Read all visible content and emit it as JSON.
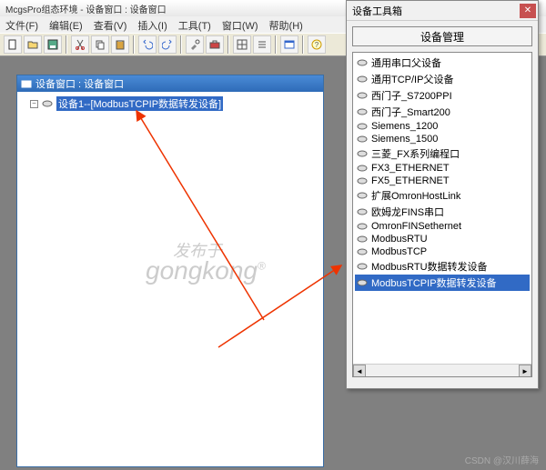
{
  "titlebar": "McgsPro组态环境 - 设备窗口 : 设备窗口",
  "menu": [
    "文件(F)",
    "编辑(E)",
    "查看(V)",
    "插入(I)",
    "工具(T)",
    "窗口(W)",
    "帮助(H)"
  ],
  "devwin": {
    "title": "设备窗口 : 设备窗口",
    "node": "设备1--[ModbusTCPIP数据转发设备]"
  },
  "toolbox": {
    "title": "设备工具箱",
    "mgmt": "设备管理",
    "items": [
      "通用串口父设备",
      "通用TCP/IP父设备",
      "西门子_S7200PPI",
      "西门子_Smart200",
      "Siemens_1200",
      "Siemens_1500",
      "三菱_FX系列编程口",
      "FX3_ETHERNET",
      "FX5_ETHERNET",
      "扩展OmronHostLink",
      "欧姆龙FINS串口",
      "OmronFINSethernet",
      "ModbusRTU",
      "ModbusTCP",
      "ModbusRTU数据转发设备",
      "ModbusTCPIP数据转发设备"
    ],
    "selected": 15
  },
  "watermark": {
    "line1": "发布于",
    "line2": "gongkong"
  },
  "csdn": "CSDN @汉川薛海"
}
